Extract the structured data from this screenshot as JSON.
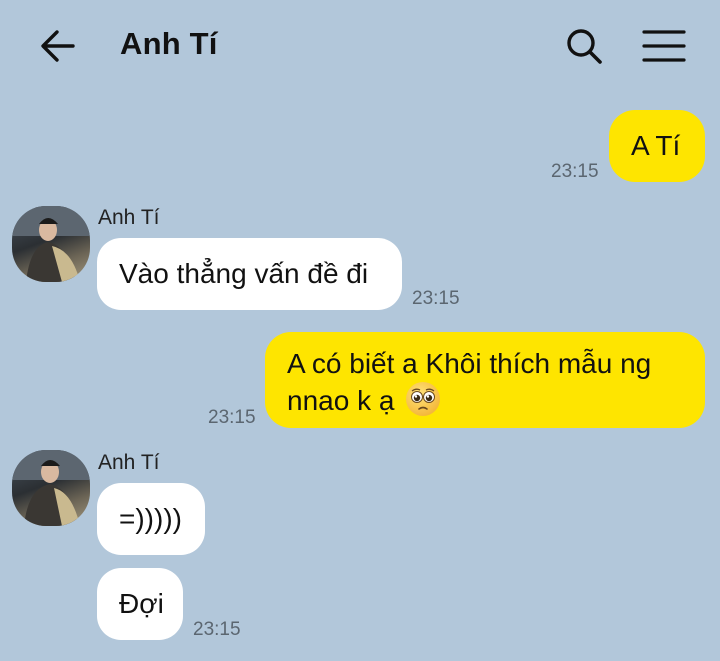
{
  "header": {
    "title": "Anh Tí",
    "back_icon": "arrow-left-icon",
    "search_icon": "search-icon",
    "menu_icon": "hamburger-menu-icon"
  },
  "colors": {
    "background": "#b2c7da",
    "outgoing_bubble": "#fee500",
    "incoming_bubble": "#ffffff"
  },
  "messages": [
    {
      "direction": "out",
      "text": "A Tí",
      "time": "23:15"
    },
    {
      "direction": "in",
      "sender": "Anh Tí",
      "text": "Vào thẳng vấn đề đi",
      "time": "23:15"
    },
    {
      "direction": "out",
      "text_line1": "A có biết a Khôi thích mẫu ng",
      "text_line2": "nnao k ạ",
      "emoji": "pleading-face-emoji",
      "time": "23:15"
    },
    {
      "direction": "in",
      "sender": "Anh Tí",
      "text": "=)))))"
    },
    {
      "direction": "in",
      "text": "Đợi",
      "time": "23:15"
    }
  ]
}
